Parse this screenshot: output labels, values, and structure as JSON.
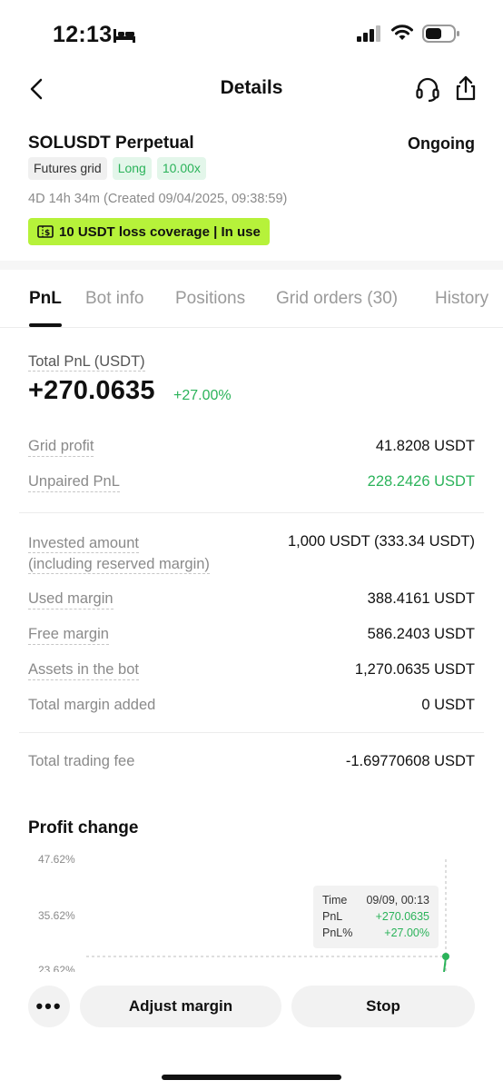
{
  "status_bar": {
    "time": "12:13",
    "icons": [
      "bed-icon",
      "signal-icon",
      "wifi-icon",
      "battery-icon"
    ]
  },
  "nav": {
    "title": "Details",
    "icons": [
      "back-icon",
      "headset-icon",
      "share-icon"
    ]
  },
  "bot": {
    "pair": "SOLUSDT Perpetual",
    "state": "Ongoing",
    "tags": [
      "Futures grid",
      "Long",
      "10.00x"
    ],
    "runtime": "4D 14h 34m (Created 09/04/2025, 09:38:59)",
    "coverage": "10 USDT loss coverage | In use"
  },
  "tabs": [
    "PnL",
    "Bot info",
    "Positions",
    "Grid orders (30)",
    "History"
  ],
  "pnl": {
    "total_label": "Total PnL (USDT)",
    "total_value": "+270.0635",
    "total_pct": "+27.00%",
    "group1": [
      {
        "label": "Grid profit",
        "value": "41.8208 USDT"
      },
      {
        "label": "Unpaired PnL",
        "value": "228.2426 USDT"
      }
    ],
    "invested_label_1": "Invested amount",
    "invested_label_2": "(including reserved margin)",
    "invested_value": "1,000 USDT (333.34 USDT)",
    "group2": [
      {
        "label": "Used margin",
        "value": "388.4161 USDT"
      },
      {
        "label": "Free margin",
        "value": "586.2403 USDT"
      },
      {
        "label": "Assets in the bot",
        "value": "1,270.0635 USDT"
      },
      {
        "label": "Total margin added",
        "value": "0 USDT"
      }
    ],
    "fee": {
      "label": "Total trading fee",
      "value": "-1.69770608 USDT"
    }
  },
  "profit_change": {
    "title": "Profit change",
    "y_ticks": [
      "47.62%",
      "35.62%",
      "23.62%"
    ],
    "tooltip": {
      "time_label": "Time",
      "time_value": "09/09, 00:13",
      "pnl_label": "PnL",
      "pnl_value": "+270.0635",
      "pct_label": "PnL%",
      "pct_value": "+27.00%"
    },
    "accent": "#2bb35a"
  },
  "actions": {
    "more": "•••",
    "adjust": "Adjust margin",
    "stop": "Stop"
  }
}
